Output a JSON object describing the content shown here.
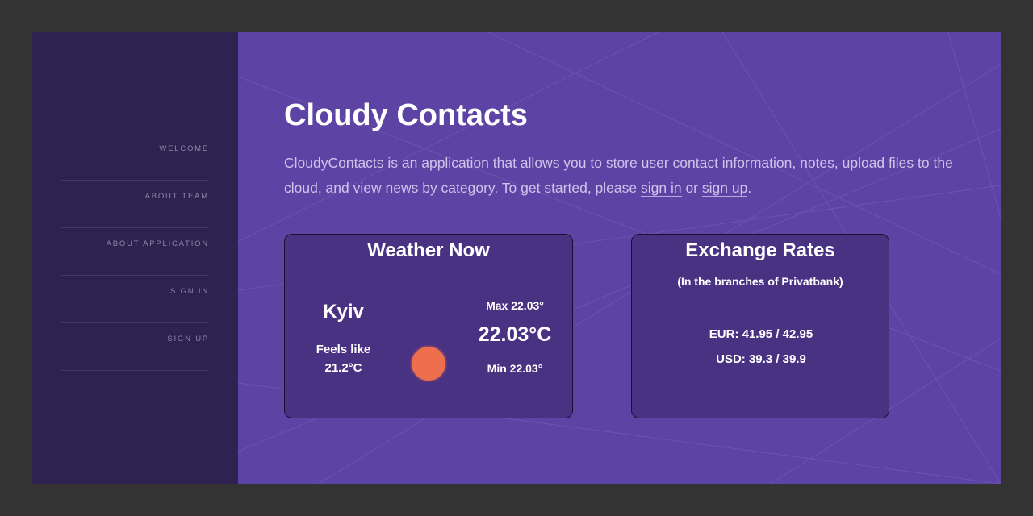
{
  "sidebar": {
    "items": [
      {
        "label": "WELCOME"
      },
      {
        "label": "ABOUT TEAM"
      },
      {
        "label": "ABOUT APPLICATION"
      },
      {
        "label": "SIGN IN"
      },
      {
        "label": "SIGN UP"
      }
    ]
  },
  "main": {
    "title": "Cloudy Contacts",
    "intro": {
      "text_before": "CloudyContacts is an application that allows you to store user contact information, notes, upload files to the cloud, and view news by category. To get started, please ",
      "sign_in_link": "sign in",
      "text_middle": " or ",
      "sign_up_link": "sign up",
      "text_after": "."
    }
  },
  "weather": {
    "title": "Weather Now",
    "city": "Kyiv",
    "feels_label": "Feels like",
    "feels_value": "21.2°C",
    "max": "Max 22.03°",
    "current": "22.03°C",
    "min": "Min 22.03°",
    "icon": "sun-icon"
  },
  "exchange": {
    "title": "Exchange Rates",
    "subtitle": "(In the branches of Privatbank)",
    "eur": "EUR: 41.95 / 42.95",
    "usd": "USD: 39.3 / 39.9"
  },
  "colors": {
    "sidebar_bg": "#2e2350",
    "main_bg": "#5d43a3",
    "card_bg": "#4a3283",
    "sun": "#ee6f4e"
  }
}
